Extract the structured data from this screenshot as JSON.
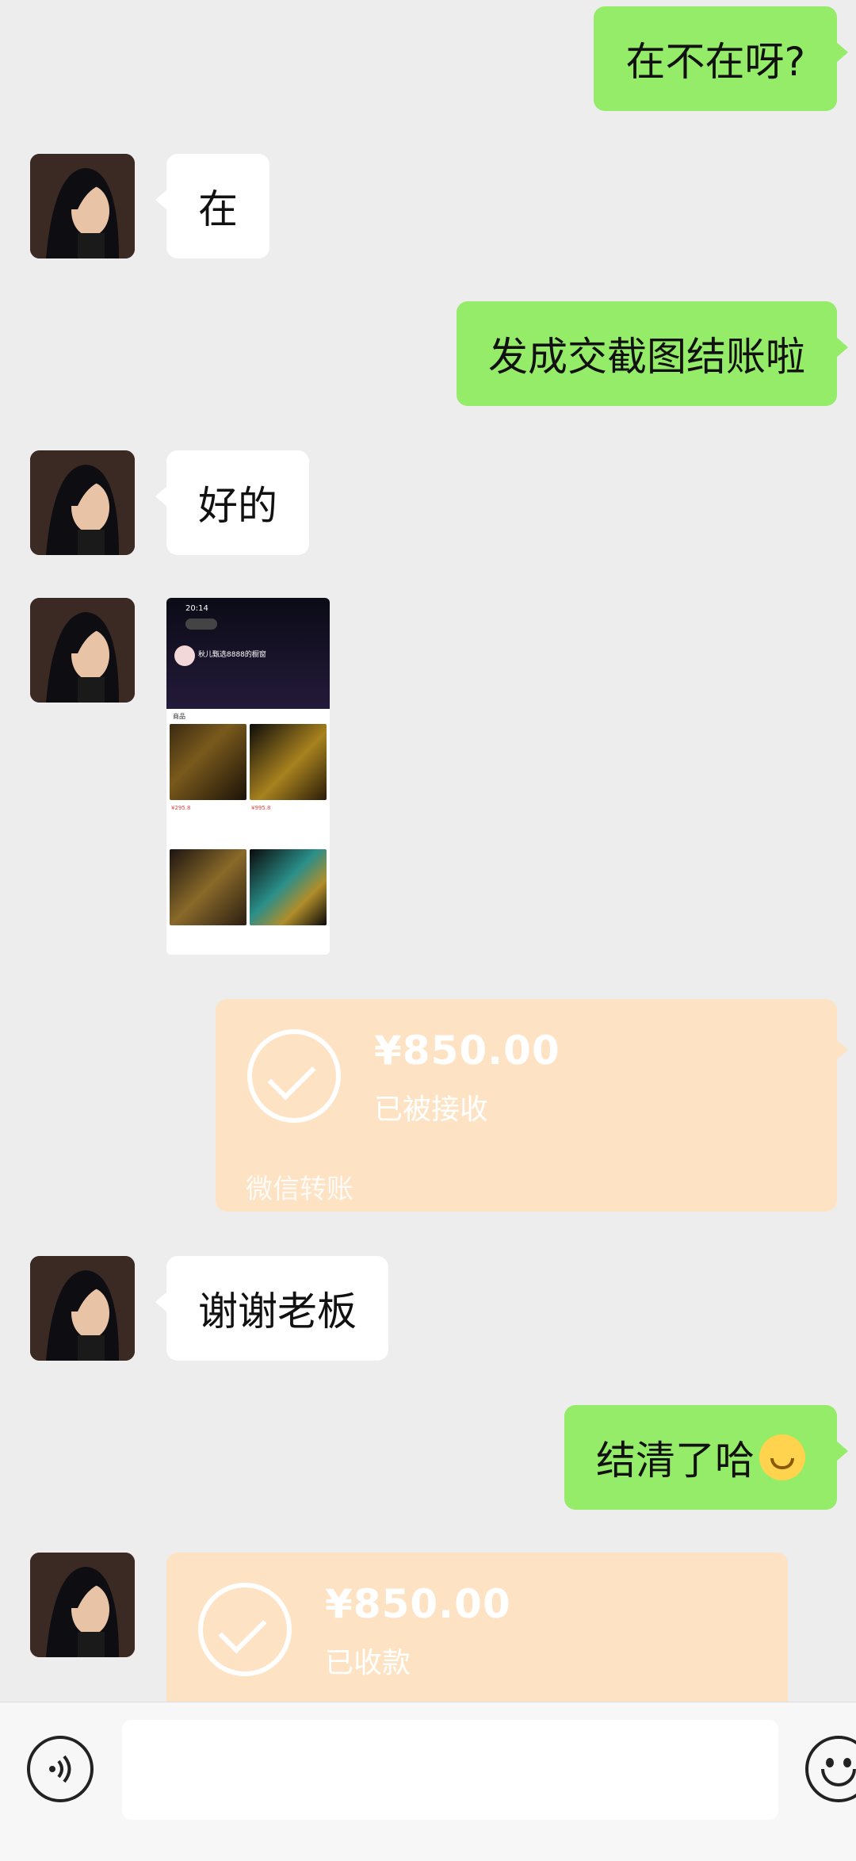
{
  "messages": {
    "m1": "在不在呀?",
    "m2": "在",
    "m3": "发成交截图结账啦",
    "m4": "好的",
    "m6": "谢谢老板",
    "m7": "结清了哈"
  },
  "shared_screenshot": {
    "time": "20:14",
    "shop_name": "秋儿甄选8888的橱窗",
    "tab_goods": "商品",
    "item1_price": "¥295.8",
    "item2_price": "¥995.8"
  },
  "transfer_sent": {
    "amount": "¥850.00",
    "status": "已被接收",
    "brand": "微信转账"
  },
  "transfer_received": {
    "amount": "¥850.00",
    "status": "已收款"
  },
  "icons": {
    "voice": "voice-icon",
    "emoji": "emoji-icon",
    "smile": "smiling-face-emoji"
  },
  "colors": {
    "outgoing_bubble": "#95ec69",
    "incoming_bubble": "#ffffff",
    "transfer_bubble": "#fde3c3",
    "background": "#ededed"
  }
}
